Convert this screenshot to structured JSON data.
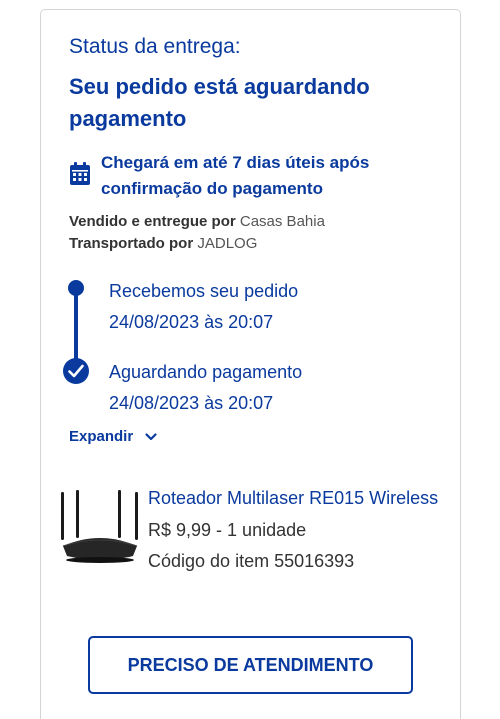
{
  "status": {
    "label": "Status da entrega:",
    "title": "Seu pedido está aguardando pagamento"
  },
  "delivery": {
    "icon": "calendar-icon",
    "text": "Chegará em até 7 dias úteis após confirmação do pagamento"
  },
  "seller": {
    "sold_label": "Vendido e entregue por",
    "sold_value": "Casas Bahia",
    "shipped_label": "Transportado por",
    "shipped_value": "JADLOG"
  },
  "timeline": [
    {
      "label": "Recebemos seu pedido",
      "date": "24/08/2023 às 20:07"
    },
    {
      "label": "Aguardando pagamento",
      "date": "24/08/2023 às 20:07"
    }
  ],
  "expand_label": "Expandir",
  "product": {
    "name": "Roteador Multilaser RE015 Wireless",
    "price": "R$ 9,99 - 1 unidade",
    "code": "Código do item 55016393"
  },
  "help_button": "PRECISO DE ATENDIMENTO",
  "colors": {
    "accent": "#0a3a9e",
    "border": "#d4d4d4"
  }
}
